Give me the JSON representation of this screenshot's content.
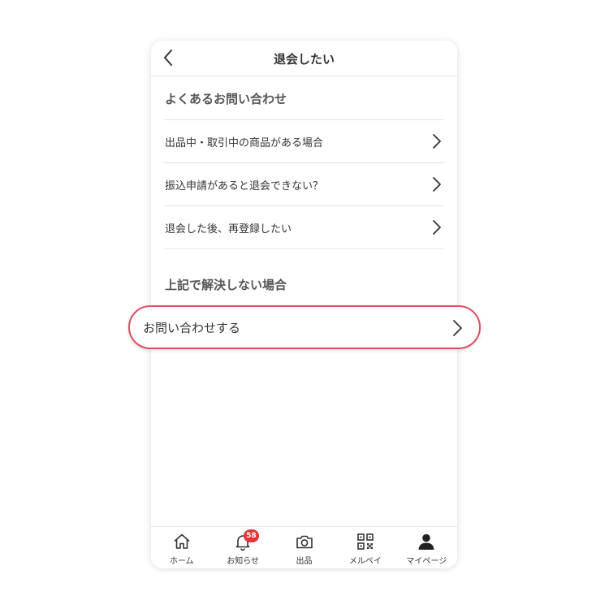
{
  "header": {
    "title": "退会したい",
    "back_icon": "chevron-left-icon"
  },
  "faq": {
    "section_title": "よくあるお問い合わせ",
    "items": [
      {
        "label": "出品中・取引中の商品がある場合"
      },
      {
        "label": "振込申請があると退会できない？"
      },
      {
        "label": "退会した後、再登録したい"
      }
    ]
  },
  "unresolved": {
    "section_title": "上記で解決しない場合",
    "contact_label": "お問い合わせする",
    "highlight_color": "#dc4e66"
  },
  "tabbar": {
    "items": [
      {
        "label": "ホーム",
        "icon": "home-icon"
      },
      {
        "label": "お知らせ",
        "icon": "bell-icon",
        "badge": "58"
      },
      {
        "label": "出品",
        "icon": "camera-icon"
      },
      {
        "label": "メルペイ",
        "icon": "qr-code-icon"
      },
      {
        "label": "マイページ",
        "icon": "person-icon"
      }
    ],
    "badge_color": "#e0353b"
  }
}
